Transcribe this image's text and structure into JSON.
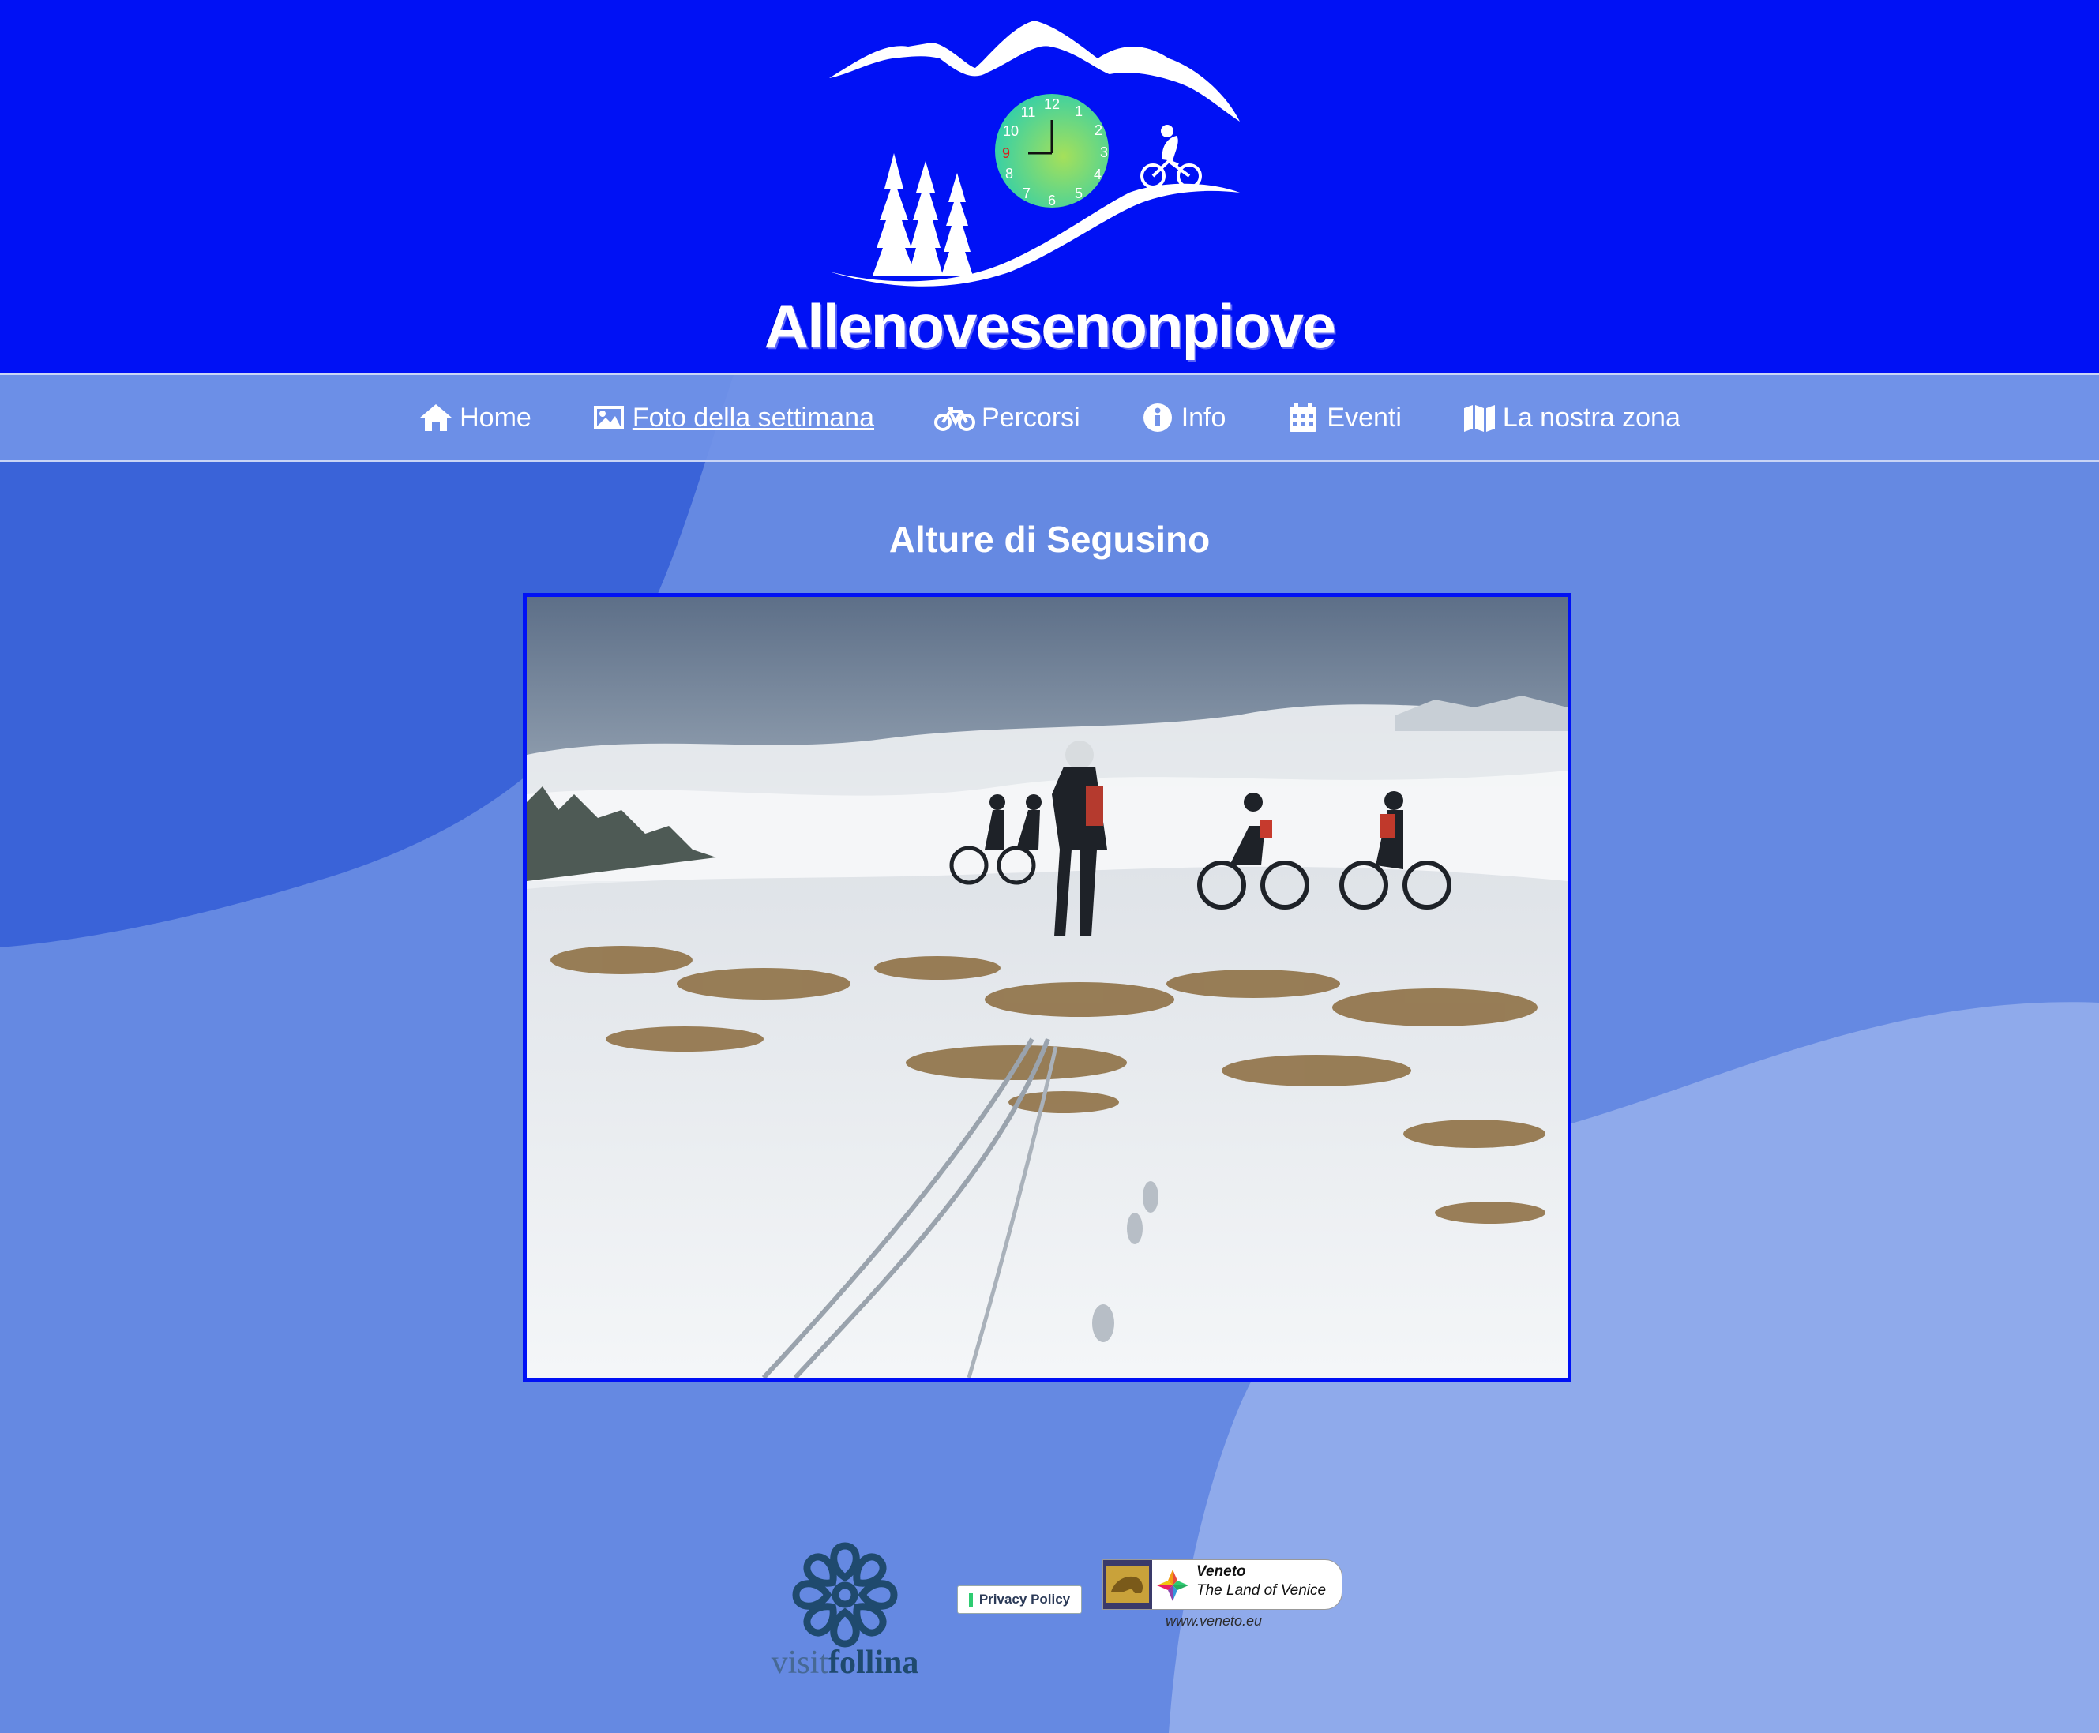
{
  "site": {
    "brand_text": "Allenovesenonpiove"
  },
  "nav": {
    "items": [
      {
        "label": "Home",
        "icon": "home-icon"
      },
      {
        "label": "Foto della settimana",
        "icon": "image-icon",
        "active": true
      },
      {
        "label": "Percorsi",
        "icon": "bicycle-icon"
      },
      {
        "label": "Info",
        "icon": "info-icon"
      },
      {
        "label": "Eventi",
        "icon": "calendar-icon"
      },
      {
        "label": "La nostra zona",
        "icon": "map-icon"
      }
    ]
  },
  "main": {
    "title": "Alture di Segusino"
  },
  "footer": {
    "visit_prefix": "visit",
    "visit_suffix": "follina",
    "privacy_label": "Privacy Policy",
    "veneto_title": "Veneto",
    "veneto_subtitle": "The Land of Venice",
    "veneto_url": "www.veneto.eu"
  },
  "colors": {
    "header_bg": "#0011f5",
    "nav_bg": "#7192e8",
    "page_bg": "#6589e2",
    "frame_border": "#0011f5",
    "follina_blue": "#1f4a6e"
  }
}
